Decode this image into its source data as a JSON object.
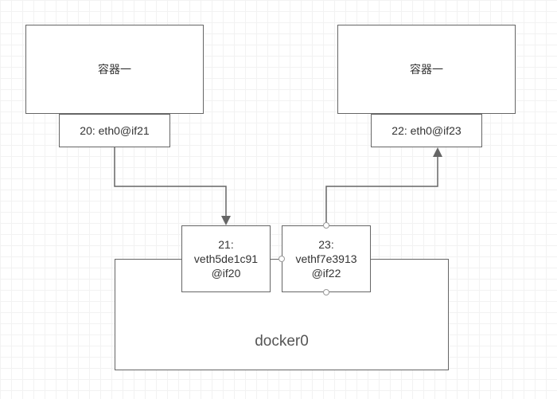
{
  "diagram": {
    "container_left": {
      "title": "容器一",
      "iface": "20: eth0@if21"
    },
    "container_right": {
      "title": "容器一",
      "iface": "22: eth0@if23"
    },
    "bridge": {
      "name": "docker0",
      "veth_left": "21:\nveth5de1c91\n@if20",
      "veth_right": "23:\nvethf7e3913\n@if22"
    }
  }
}
